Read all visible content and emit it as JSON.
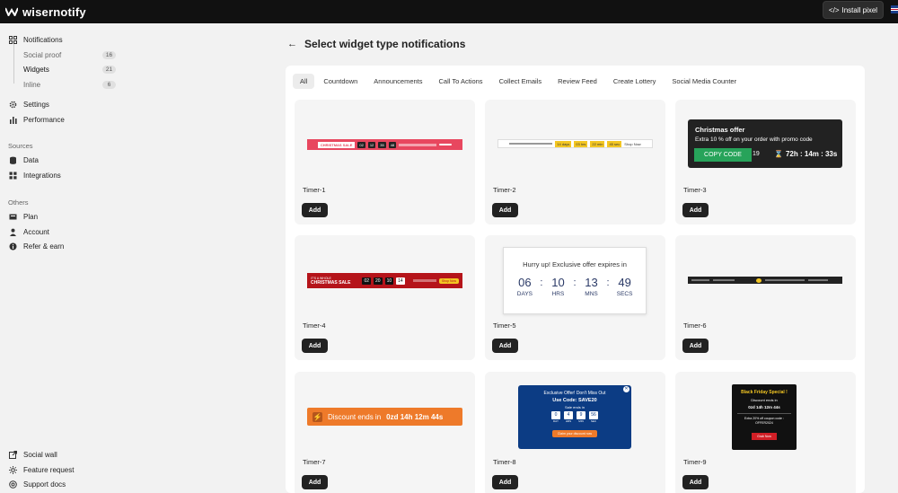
{
  "app": {
    "name": "wisernotify"
  },
  "topbar": {
    "install_label": "Install pixel",
    "install_icon": "code-icon"
  },
  "sidebar": {
    "notifications": "Notifications",
    "sub": [
      {
        "label": "Social proof",
        "count": "16"
      },
      {
        "label": "Widgets",
        "count": "21"
      },
      {
        "label": "Inline",
        "count": "6"
      }
    ],
    "settings": "Settings",
    "performance": "Performance",
    "sources_label": "Sources",
    "data": "Data",
    "integrations": "Integrations",
    "others_label": "Others",
    "plan": "Plan",
    "account": "Account",
    "refer": "Refer & earn",
    "social_wall": "Social wall",
    "feature_request": "Feature request",
    "support_docs": "Support docs"
  },
  "header": {
    "title": "Select widget type notifications"
  },
  "tabs": [
    "All",
    "Countdown",
    "Announcements",
    "Call To Actions",
    "Collect Emails",
    "Review Feed",
    "Create Lottery",
    "Social Media Counter"
  ],
  "add_label": "Add",
  "cards": [
    "Timer-1",
    "Timer-2",
    "Timer-3",
    "Timer-4",
    "Timer-5",
    "Timer-6",
    "Timer-7",
    "Timer-8",
    "Timer-9"
  ],
  "previews": {
    "t1": {
      "title": "CHRISTMAS SALE",
      "digits": [
        "02",
        "12",
        "35",
        "48"
      ]
    },
    "t2": {
      "digits": [
        "14 days",
        "03 hrs",
        "22 min",
        "45 sec"
      ],
      "cta": "Shop Now"
    },
    "t3": {
      "title": "Christmas offer",
      "text": "Extra 10 % off on your order with promo code",
      "code": "COPY CODE",
      "timer": "72h : 14m : 33s"
    },
    "t4": {
      "line1": "IT'S A WHOLE",
      "line2": "CHRISTMAS SALE",
      "digits": [
        "02",
        "20",
        "10",
        "14"
      ],
      "cta": "Shop Now"
    },
    "t5": {
      "title": "Hurry up! Exclusive offer expires in",
      "units": [
        {
          "num": "06",
          "lbl": "DAYS"
        },
        {
          "num": "10",
          "lbl": "HRS"
        },
        {
          "num": "13",
          "lbl": "MNS"
        },
        {
          "num": "49",
          "lbl": "SECS"
        }
      ]
    },
    "t7": {
      "text": "Discount ends in",
      "timer": "0zd 14h 12m 44s"
    },
    "t8": {
      "title": "Exclusive Offer! Don't Miss Out",
      "code": "Use Code: SAVE20",
      "sub": "Sale ends in",
      "digits": [
        "0",
        "4",
        "9",
        "56"
      ],
      "labels": [
        "DAY",
        "HRS",
        "MIN",
        "SEC"
      ],
      "cta": "Claim your discount now"
    },
    "t9": {
      "title": "Black Friday Special !",
      "sub": "Discount ends in",
      "timer": "0zd 14h 12m 44s",
      "text": "Extra 20% off coupon code : OFFER2024",
      "cta": "Grab Now"
    }
  },
  "colors": {
    "accent_red": "#e8475f",
    "dark": "#222222",
    "green": "#27a35a",
    "orange": "#ee7a2a",
    "navy": "#0c3c84"
  }
}
